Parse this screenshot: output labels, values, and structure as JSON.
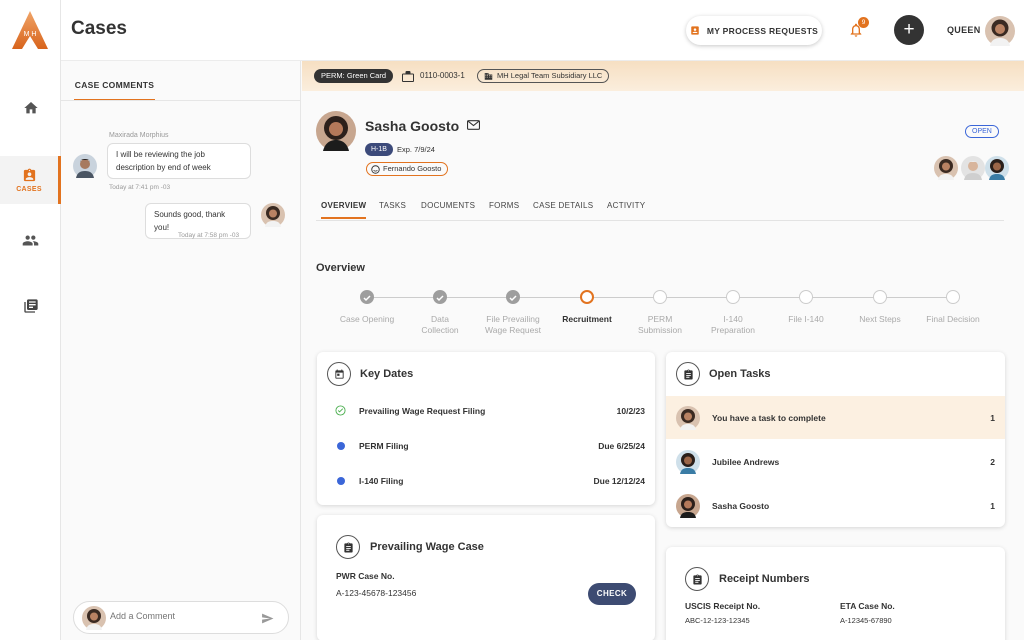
{
  "app": {
    "logo_text": "M H",
    "page_title": "Cases",
    "process_requests_label": "MY PROCESS REQUESTS",
    "notification_count": "9",
    "add_label": "+",
    "user_name": "QUEEN"
  },
  "nav": {
    "cases_label": "CASES"
  },
  "comments": {
    "tab_label": "CASE COMMENTS",
    "messages": [
      {
        "sender": "Maxirada Morphius",
        "text_line1": "I will be reviewing the job",
        "text_line2": "description by end of week",
        "time": "Today at 7:41 pm -03"
      },
      {
        "text": "Sounds good, thank you!",
        "time": "Today at 7:58 pm -03"
      }
    ],
    "input_placeholder": "Add a Comment"
  },
  "case": {
    "type": "PERM: Green Card",
    "number": "0110-0003-1",
    "company": "MH Legal Team Subsidiary LLC",
    "client_name": "Sasha Goosto",
    "visa": "H-1B",
    "expiry": "Exp. 7/9/24",
    "relation": "Fernando Goosto",
    "status": "OPEN"
  },
  "tabs": [
    "OVERVIEW",
    "TASKS",
    "DOCUMENTS",
    "FORMS",
    "CASE DETAILS",
    "ACTIVITY"
  ],
  "overview": {
    "title": "Overview",
    "steps": [
      {
        "line1": "Case Opening",
        "line2": "",
        "state": "done"
      },
      {
        "line1": "Data",
        "line2": "Collection",
        "state": "done"
      },
      {
        "line1": "File Prevailing",
        "line2": "Wage Request",
        "state": "done"
      },
      {
        "line1": "Recruitment",
        "line2": "",
        "state": "current"
      },
      {
        "line1": "PERM",
        "line2": "Submission",
        "state": "todo"
      },
      {
        "line1": "I-140",
        "line2": "Preparation",
        "state": "todo"
      },
      {
        "line1": "File I-140",
        "line2": "",
        "state": "todo"
      },
      {
        "line1": "Next Steps",
        "line2": "",
        "state": "todo"
      },
      {
        "line1": "Final Decision",
        "line2": "",
        "state": "todo"
      }
    ]
  },
  "key_dates": {
    "title": "Key Dates",
    "items": [
      {
        "label": "Prevailing Wage Request Filing",
        "date": "10/2/23"
      },
      {
        "label": "PERM Filing",
        "date": "Due 6/25/24"
      },
      {
        "label": "I-140 Filing",
        "date": "Due 12/12/24"
      }
    ]
  },
  "open_tasks": {
    "title": "Open Tasks",
    "items": [
      {
        "text": "You have a task to complete",
        "count": "1"
      },
      {
        "text": "Jubilee Andrews",
        "count": "2"
      },
      {
        "text": "Sasha Goosto",
        "count": "1"
      }
    ]
  },
  "pwr": {
    "title": "Prevailing Wage Case",
    "label": "PWR Case No.",
    "value": "A-123-45678-123456",
    "button": "CHECK"
  },
  "receipts": {
    "title": "Receipt Numbers",
    "uscis_label": "USCIS Receipt No.",
    "uscis_value": "ABC-12-123-12345",
    "eta_label": "ETA Case No.",
    "eta_value": "A-12345-67890"
  },
  "colors": {
    "accent": "#e2731f",
    "navy": "#3d4b72",
    "blue": "#3b66d8"
  }
}
